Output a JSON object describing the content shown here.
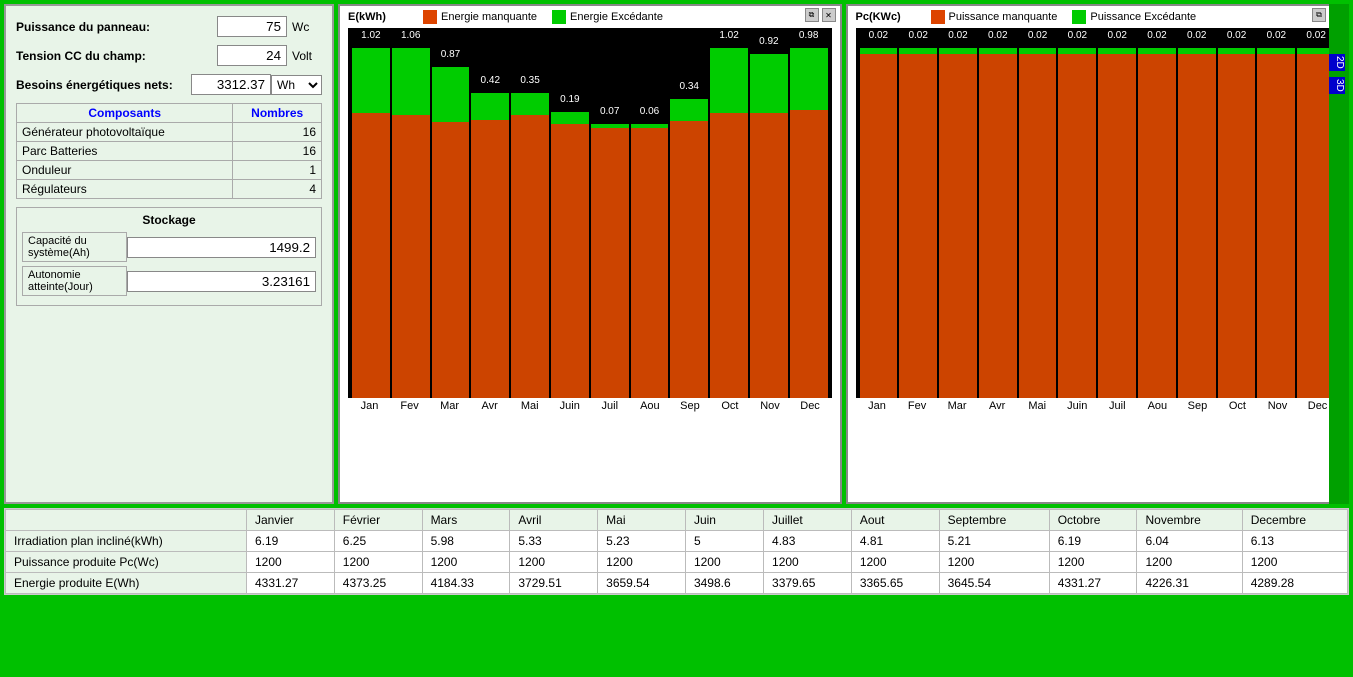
{
  "leftPanel": {
    "puissanceLabel": "Puissance du panneau:",
    "puissanceValue": "75",
    "puissanceUnit": "Wc",
    "tensionLabel": "Tension CC du champ:",
    "tensionValue": "24",
    "tensionUnit": "Volt",
    "besoinsLabel": "Besoins énergétiques nets:",
    "besoinsValue": "3312.37",
    "besoinsUnit": "Wh",
    "composants": {
      "col1": "Composants",
      "col2": "Nombres",
      "rows": [
        {
          "name": "Générateur photovoltaïque",
          "value": "16"
        },
        {
          "name": "Parc Batteries",
          "value": "16"
        },
        {
          "name": "Onduleur",
          "value": "1"
        },
        {
          "name": "Régulateurs",
          "value": "4"
        }
      ]
    },
    "stockage": {
      "title": "Stockage",
      "fields": [
        {
          "label": "Capacité du système(Ah)",
          "value": "1499.2"
        },
        {
          "label": "Autonomie atteinte(Jour)",
          "value": "3.23161"
        }
      ]
    }
  },
  "chart1": {
    "title": "E(kWh)",
    "legend": [
      {
        "label": "Energie manquante",
        "color": "#dd4400"
      },
      {
        "label": "Energie Excédante",
        "color": "#00cc00"
      }
    ],
    "bars": [
      {
        "month": "Jan",
        "green": 1.02,
        "total": 5.5
      },
      {
        "month": "Fev",
        "green": 1.06,
        "total": 5.5
      },
      {
        "month": "Mar",
        "green": 0.87,
        "total": 5.2
      },
      {
        "month": "Avr",
        "green": 0.42,
        "total": 4.8
      },
      {
        "month": "Mai",
        "green": 0.35,
        "total": 4.8
      },
      {
        "month": "Juin",
        "green": 0.19,
        "total": 4.5
      },
      {
        "month": "Juil",
        "green": 0.07,
        "total": 4.3
      },
      {
        "month": "Aou",
        "green": 0.06,
        "total": 4.3
      },
      {
        "month": "Sep",
        "green": 0.34,
        "total": 4.7
      },
      {
        "month": "Oct",
        "green": 1.02,
        "total": 5.5
      },
      {
        "month": "Nov",
        "green": 0.92,
        "total": 5.4
      },
      {
        "month": "Dec",
        "green": 0.98,
        "total": 5.5
      }
    ]
  },
  "chart2": {
    "title": "Pc(KWc)",
    "legend": [
      {
        "label": "Puissance manquante",
        "color": "#dd4400"
      },
      {
        "label": "Puissance Excédante",
        "color": "#00cc00"
      }
    ],
    "bars": [
      {
        "month": "Jan",
        "green": 0.02,
        "total": 1.2
      },
      {
        "month": "Fev",
        "green": 0.02,
        "total": 1.2
      },
      {
        "month": "Mar",
        "green": 0.02,
        "total": 1.2
      },
      {
        "month": "Avr",
        "green": 0.02,
        "total": 1.2
      },
      {
        "month": "Mai",
        "green": 0.02,
        "total": 1.2
      },
      {
        "month": "Juin",
        "green": 0.02,
        "total": 1.2
      },
      {
        "month": "Juil",
        "green": 0.02,
        "total": 1.2
      },
      {
        "month": "Aou",
        "green": 0.02,
        "total": 1.2
      },
      {
        "month": "Sep",
        "green": 0.02,
        "total": 1.2
      },
      {
        "month": "Oct",
        "green": 0.02,
        "total": 1.2
      },
      {
        "month": "Nov",
        "green": 0.02,
        "total": 1.2
      },
      {
        "month": "Dec",
        "green": 0.02,
        "total": 1.2
      }
    ]
  },
  "sideButtons": [
    "2D",
    "3D"
  ],
  "dataTable": {
    "headers": [
      "",
      "Janvier",
      "Février",
      "Mars",
      "Avril",
      "Mai",
      "Juin",
      "Juillet",
      "Aout",
      "Septembre",
      "Octobre",
      "Novembre",
      "Decembre"
    ],
    "rows": [
      {
        "label": "Irradiation plan incliné(kWh)",
        "values": [
          "6.19",
          "6.25",
          "5.98",
          "5.33",
          "5.23",
          "5",
          "4.83",
          "4.81",
          "5.21",
          "6.19",
          "6.04",
          "6.13"
        ]
      },
      {
        "label": "Puissance produite Pc(Wc)",
        "values": [
          "1200",
          "1200",
          "1200",
          "1200",
          "1200",
          "1200",
          "1200",
          "1200",
          "1200",
          "1200",
          "1200",
          "1200"
        ]
      },
      {
        "label": "Energie produite E(Wh)",
        "values": [
          "4331.27",
          "4373.25",
          "4184.33",
          "3729.51",
          "3659.54",
          "3498.6",
          "3379.65",
          "3365.65",
          "3645.54",
          "4331.27",
          "4226.31",
          "4289.28"
        ]
      }
    ]
  }
}
